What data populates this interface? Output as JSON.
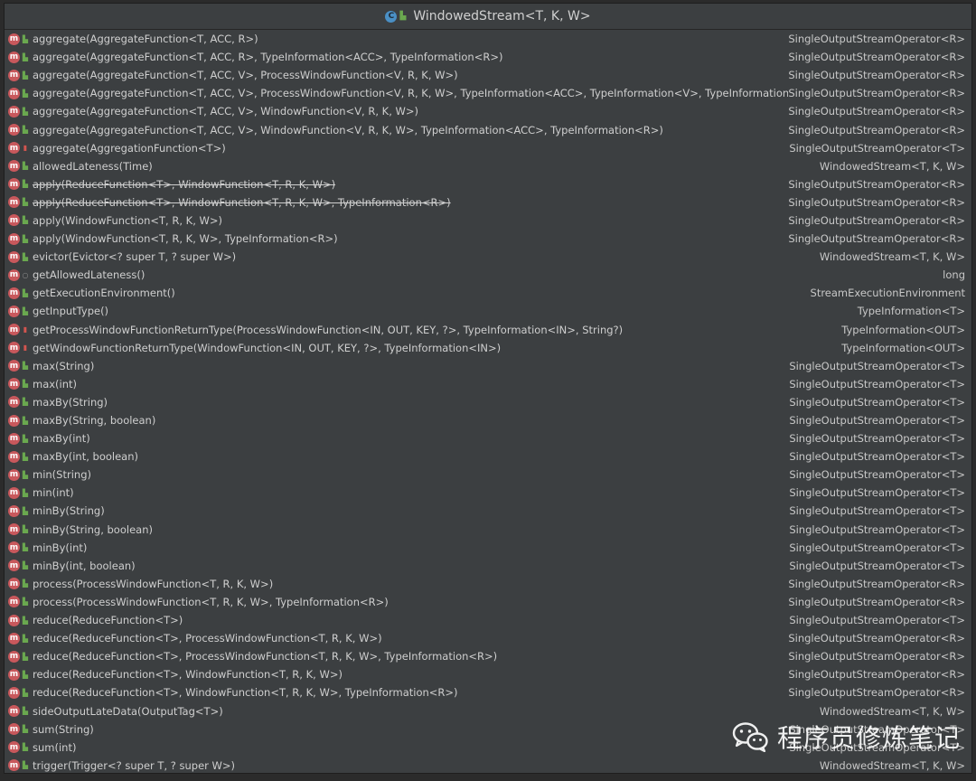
{
  "window": {
    "title": "WindowedStream<T, K, W>",
    "class_icon": "C"
  },
  "methods": [
    {
      "sig": "aggregate(AggregateFunction<T, ACC, R>)",
      "ret": "SingleOutputStreamOperator<R>",
      "vis": "public",
      "deprecated": false
    },
    {
      "sig": "aggregate(AggregateFunction<T, ACC, R>, TypeInformation<ACC>, TypeInformation<R>)",
      "ret": "SingleOutputStreamOperator<R>",
      "vis": "public",
      "deprecated": false
    },
    {
      "sig": "aggregate(AggregateFunction<T, ACC, V>, ProcessWindowFunction<V, R, K, W>)",
      "ret": "SingleOutputStreamOperator<R>",
      "vis": "public",
      "deprecated": false
    },
    {
      "sig": "aggregate(AggregateFunction<T, ACC, V>, ProcessWindowFunction<V, R, K, W>, TypeInformation<ACC>, TypeInformation<V>, TypeInformation<R>)",
      "ret": "SingleOutputStreamOperator<R>",
      "vis": "public",
      "deprecated": false
    },
    {
      "sig": "aggregate(AggregateFunction<T, ACC, V>, WindowFunction<V, R, K, W>)",
      "ret": "SingleOutputStreamOperator<R>",
      "vis": "public",
      "deprecated": false
    },
    {
      "sig": "aggregate(AggregateFunction<T, ACC, V>, WindowFunction<V, R, K, W>, TypeInformation<ACC>, TypeInformation<R>)",
      "ret": "SingleOutputStreamOperator<R>",
      "vis": "public",
      "deprecated": false
    },
    {
      "sig": "aggregate(AggregationFunction<T>)",
      "ret": "SingleOutputStreamOperator<T>",
      "vis": "private",
      "deprecated": false
    },
    {
      "sig": "allowedLateness(Time)",
      "ret": "WindowedStream<T, K, W>",
      "vis": "public",
      "deprecated": false
    },
    {
      "sig": "apply(ReduceFunction<T>, WindowFunction<T, R, K, W>)",
      "ret": "SingleOutputStreamOperator<R>",
      "vis": "public",
      "deprecated": true
    },
    {
      "sig": "apply(ReduceFunction<T>, WindowFunction<T, R, K, W>, TypeInformation<R>)",
      "ret": "SingleOutputStreamOperator<R>",
      "vis": "public",
      "deprecated": true
    },
    {
      "sig": "apply(WindowFunction<T, R, K, W>)",
      "ret": "SingleOutputStreamOperator<R>",
      "vis": "public",
      "deprecated": false
    },
    {
      "sig": "apply(WindowFunction<T, R, K, W>, TypeInformation<R>)",
      "ret": "SingleOutputStreamOperator<R>",
      "vis": "public",
      "deprecated": false
    },
    {
      "sig": "evictor(Evictor<? super T, ? super W>)",
      "ret": "WindowedStream<T, K, W>",
      "vis": "public",
      "deprecated": false
    },
    {
      "sig": "getAllowedLateness()",
      "ret": "long",
      "vis": "package",
      "deprecated": false
    },
    {
      "sig": "getExecutionEnvironment()",
      "ret": "StreamExecutionEnvironment",
      "vis": "public",
      "deprecated": false
    },
    {
      "sig": "getInputType()",
      "ret": "TypeInformation<T>",
      "vis": "public",
      "deprecated": false
    },
    {
      "sig": "getProcessWindowFunctionReturnType(ProcessWindowFunction<IN, OUT, KEY, ?>, TypeInformation<IN>, String?)",
      "ret": "TypeInformation<OUT>",
      "vis": "private",
      "deprecated": false
    },
    {
      "sig": "getWindowFunctionReturnType(WindowFunction<IN, OUT, KEY, ?>, TypeInformation<IN>)",
      "ret": "TypeInformation<OUT>",
      "vis": "private",
      "deprecated": false
    },
    {
      "sig": "max(String)",
      "ret": "SingleOutputStreamOperator<T>",
      "vis": "public",
      "deprecated": false
    },
    {
      "sig": "max(int)",
      "ret": "SingleOutputStreamOperator<T>",
      "vis": "public",
      "deprecated": false
    },
    {
      "sig": "maxBy(String)",
      "ret": "SingleOutputStreamOperator<T>",
      "vis": "public",
      "deprecated": false
    },
    {
      "sig": "maxBy(String, boolean)",
      "ret": "SingleOutputStreamOperator<T>",
      "vis": "public",
      "deprecated": false
    },
    {
      "sig": "maxBy(int)",
      "ret": "SingleOutputStreamOperator<T>",
      "vis": "public",
      "deprecated": false
    },
    {
      "sig": "maxBy(int, boolean)",
      "ret": "SingleOutputStreamOperator<T>",
      "vis": "public",
      "deprecated": false
    },
    {
      "sig": "min(String)",
      "ret": "SingleOutputStreamOperator<T>",
      "vis": "public",
      "deprecated": false
    },
    {
      "sig": "min(int)",
      "ret": "SingleOutputStreamOperator<T>",
      "vis": "public",
      "deprecated": false
    },
    {
      "sig": "minBy(String)",
      "ret": "SingleOutputStreamOperator<T>",
      "vis": "public",
      "deprecated": false
    },
    {
      "sig": "minBy(String, boolean)",
      "ret": "SingleOutputStreamOperator<T>",
      "vis": "public",
      "deprecated": false
    },
    {
      "sig": "minBy(int)",
      "ret": "SingleOutputStreamOperator<T>",
      "vis": "public",
      "deprecated": false
    },
    {
      "sig": "minBy(int, boolean)",
      "ret": "SingleOutputStreamOperator<T>",
      "vis": "public",
      "deprecated": false
    },
    {
      "sig": "process(ProcessWindowFunction<T, R, K, W>)",
      "ret": "SingleOutputStreamOperator<R>",
      "vis": "public",
      "deprecated": false
    },
    {
      "sig": "process(ProcessWindowFunction<T, R, K, W>, TypeInformation<R>)",
      "ret": "SingleOutputStreamOperator<R>",
      "vis": "public",
      "deprecated": false
    },
    {
      "sig": "reduce(ReduceFunction<T>)",
      "ret": "SingleOutputStreamOperator<T>",
      "vis": "public",
      "deprecated": false
    },
    {
      "sig": "reduce(ReduceFunction<T>, ProcessWindowFunction<T, R, K, W>)",
      "ret": "SingleOutputStreamOperator<R>",
      "vis": "public",
      "deprecated": false
    },
    {
      "sig": "reduce(ReduceFunction<T>, ProcessWindowFunction<T, R, K, W>, TypeInformation<R>)",
      "ret": "SingleOutputStreamOperator<R>",
      "vis": "public",
      "deprecated": false
    },
    {
      "sig": "reduce(ReduceFunction<T>, WindowFunction<T, R, K, W>)",
      "ret": "SingleOutputStreamOperator<R>",
      "vis": "public",
      "deprecated": false
    },
    {
      "sig": "reduce(ReduceFunction<T>, WindowFunction<T, R, K, W>, TypeInformation<R>)",
      "ret": "SingleOutputStreamOperator<R>",
      "vis": "public",
      "deprecated": false
    },
    {
      "sig": "sideOutputLateData(OutputTag<T>)",
      "ret": "WindowedStream<T, K, W>",
      "vis": "public",
      "deprecated": false
    },
    {
      "sig": "sum(String)",
      "ret": "SingleOutputStreamOperator<T>",
      "vis": "public",
      "deprecated": false
    },
    {
      "sig": "sum(int)",
      "ret": "SingleOutputStreamOperator<T>",
      "vis": "public",
      "deprecated": false
    },
    {
      "sig": "trigger(Trigger<? super T, ? super W>)",
      "ret": "WindowedStream<T, K, W>",
      "vis": "public",
      "deprecated": false
    }
  ],
  "icons": {
    "method": "m",
    "public": "public-visibility-icon",
    "private": "lock-icon",
    "package": "package-visibility-icon"
  },
  "watermark": {
    "text": "程序员修炼笔记",
    "icon": "wechat-icon"
  },
  "colors": {
    "background": "#3c3f41",
    "method_icon": "#c8585c",
    "public": "#6aa84f",
    "private": "#d2554f",
    "text": "#cfcfcf"
  }
}
